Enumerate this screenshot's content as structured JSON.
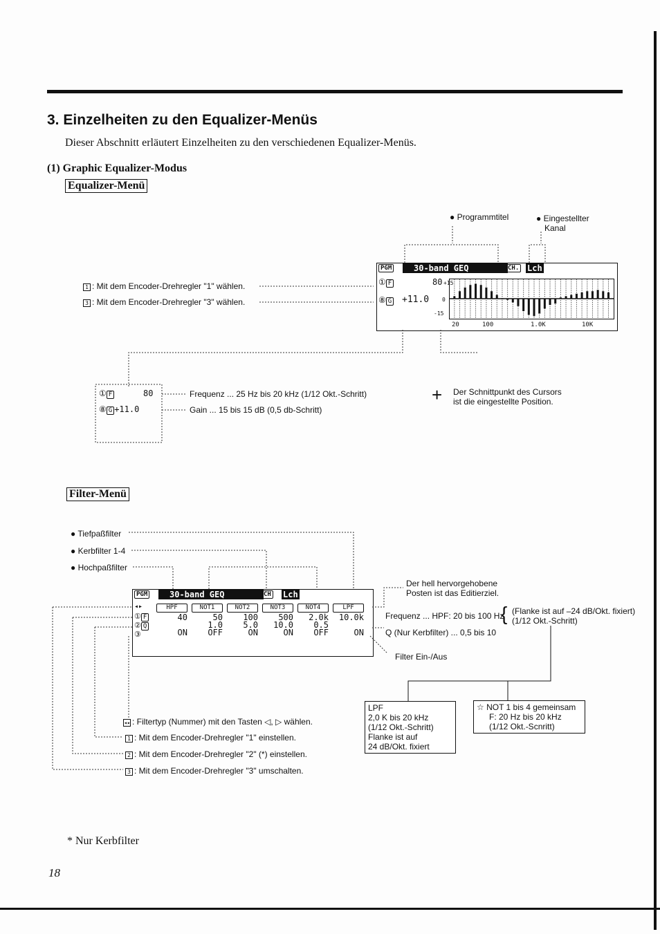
{
  "section": {
    "title": "3. Einzelheiten zu den Equalizer-Menüs",
    "intro": "Dieser Abschnitt erläutert Einzelheiten zu den verschiedenen Equalizer-Menüs.",
    "subtitle": "(1) Graphic Equalizer-Modus"
  },
  "eq_menu": {
    "label": "Equalizer-Menü",
    "callout_program": "● Programmtitel",
    "callout_channel_1": "● Eingestellter",
    "callout_channel_2": "Kanal",
    "note_1": ": Mit dem Encoder-Drehregler \"1\" wählen.",
    "note_3": ": Mit dem Encoder-Drehregler \"3\" wählen.",
    "lcd": {
      "pgm": "PGM",
      "title": "30-band GEQ",
      "ch": "CH.",
      "channel": "Lch",
      "f_key": "F",
      "g_key": "G",
      "freq_value": "80",
      "gain_value": "+11.0",
      "y_top": "+15",
      "y_mid": "0",
      "y_bottom": "-15",
      "x_ticks": [
        "20",
        "100",
        "1.0K",
        "10K"
      ],
      "band_gains_db": [
        2,
        6,
        9,
        11,
        12,
        11,
        9,
        6,
        3,
        0,
        -1,
        -3,
        -6,
        -10,
        -13,
        -14,
        -12,
        -8,
        -5,
        -4,
        1,
        2,
        3,
        4,
        5,
        6,
        6,
        7,
        6,
        5
      ]
    },
    "freq_desc": "Frequenz ... 25 Hz bis 20 kHz (1/12 Okt.-Schritt)",
    "gain_desc": "Gain ... 15 bis 15 dB (0,5 db-Schritt)",
    "cursor_desc_1": "Der Schnittpunkt des Cursors",
    "cursor_desc_2": "ist die eingestellte Position."
  },
  "filter_menu": {
    "label": "Filter-Menü",
    "bullet_lpf": "● Tiefpaßfilter",
    "bullet_notch": "● Kerbfilter 1-4",
    "bullet_hpf": "● Hochpaßfilter",
    "highlight_1": "Der hell hervorgehobene",
    "highlight_2": "Posten ist das Editierziel.",
    "freq_desc": "Frequenz ... HPF: 20 bis 100 Hz",
    "freq_note_1": "(Flanke ist auf –24 dB/Okt. fixiert)",
    "freq_note_2": "(1/12 Okt.-Schritt)",
    "q_desc": "Q (Nur Kerbfilter) ... 0,5 bis 10",
    "onoff_desc": "Filter Ein-/Aus",
    "lcd": {
      "pgm": "PGM",
      "title": "30-band GEQ",
      "ch": "CH",
      "channel": "Lch",
      "f_key": "F",
      "q_key": "Q",
      "tabs": [
        "HPF",
        "NOT1",
        "NOT2",
        "NOT3",
        "NOT4",
        "LPF"
      ],
      "freq": [
        "40",
        "50",
        "100",
        "500",
        "2.0k",
        "10.0k"
      ],
      "q": [
        "",
        "1.0",
        "5.0",
        "10.0",
        "0.5",
        ""
      ],
      "state": [
        "ON",
        "OFF",
        "ON",
        "ON",
        "OFF",
        "ON"
      ]
    },
    "lpf_box": [
      "LPF",
      "2,0 K bis 20 kHz",
      "(1/12 Okt.-Schritt)",
      "Flanke ist auf",
      "24 dB/Okt. fixiert"
    ],
    "notch_box": [
      "☆ NOT 1 bis 4 gemeinsam",
      "F: 20 Hz bis 20 kHz",
      "(1/12 Okt.-Scnritt)"
    ],
    "note_arrows": ": Filtertyp (Nummer) mit den Tasten ◁, ▷ wählen.",
    "note_1": ": Mit dem Encoder-Drehregler \"1\" einstellen.",
    "note_2": ": Mit dem Encoder-Drehregler \"2\" (*) einstellen.",
    "note_3": ": Mit dem Encoder-Drehregler \"3\" umschalten."
  },
  "footnote": "*  Nur Kerbfilter",
  "page_number": "18"
}
